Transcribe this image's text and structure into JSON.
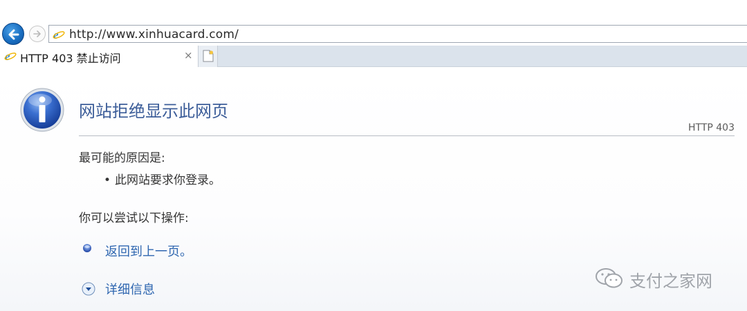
{
  "address_bar": {
    "url": "http://www.xinhuacard.com/"
  },
  "tab": {
    "title": "HTTP 403 禁止访问",
    "close_glyph": "×"
  },
  "page": {
    "title": "网站拒绝显示此网页",
    "http_code": "HTTP 403",
    "reason_heading": "最可能的原因是:",
    "reasons": [
      "此网站要求你登录。"
    ],
    "try_heading": "你可以尝试以下操作:",
    "actions": {
      "back": "返回到上一页。",
      "details": "详细信息"
    }
  },
  "watermark": {
    "text": "支付之家网"
  },
  "icons": {
    "back": "back-arrow-icon",
    "forward": "forward-arrow-icon",
    "ie": "ie-logo-icon",
    "new_tab": "new-tab-icon",
    "info": "info-icon",
    "bullet": "blue-bullet-icon",
    "expand": "chevron-down-circle-icon",
    "wechat": "wechat-icon"
  },
  "colors": {
    "title": "#3c5d99",
    "link": "#2e66b0",
    "accent": "#1a6fc2"
  }
}
